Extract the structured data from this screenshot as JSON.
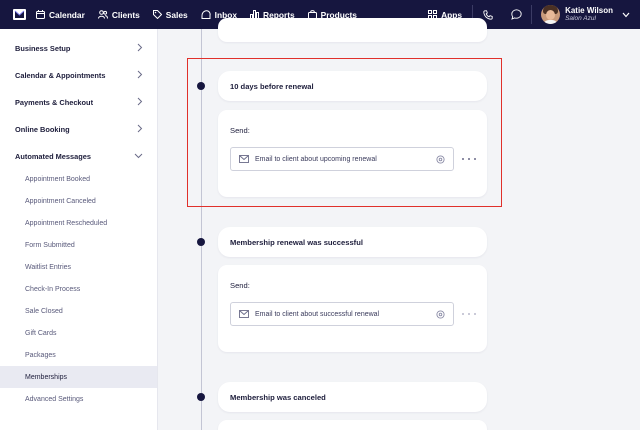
{
  "nav": {
    "items": [
      {
        "label": "Calendar",
        "icon": "calendar-icon"
      },
      {
        "label": "Clients",
        "icon": "clients-icon"
      },
      {
        "label": "Sales",
        "icon": "tag-icon"
      },
      {
        "label": "Inbox",
        "icon": "inbox-icon"
      },
      {
        "label": "Reports",
        "icon": "bar-chart-icon"
      },
      {
        "label": "Products",
        "icon": "bag-icon"
      }
    ],
    "apps_label": "Apps",
    "user": {
      "name": "Katie Wilson",
      "business": "Salon Azul"
    }
  },
  "sidebar": {
    "sections": [
      {
        "label": "Business Setup"
      },
      {
        "label": "Calendar & Appointments"
      },
      {
        "label": "Payments & Checkout"
      },
      {
        "label": "Online Booking"
      },
      {
        "label": "Automated Messages"
      }
    ],
    "sub_items": [
      {
        "label": "Appointment Booked"
      },
      {
        "label": "Appointment Canceled"
      },
      {
        "label": "Appointment Rescheduled"
      },
      {
        "label": "Form Submitted"
      },
      {
        "label": "Waitlist Entries"
      },
      {
        "label": "Check-In Process"
      },
      {
        "label": "Sale Closed"
      },
      {
        "label": "Gift Cards"
      },
      {
        "label": "Packages"
      },
      {
        "label": "Memberships",
        "active": true
      },
      {
        "label": "Advanced Settings"
      }
    ]
  },
  "timeline": {
    "events": [
      {
        "title": "10 days before renewal",
        "send_label": "Send:",
        "message": "Email to client about upcoming renewal"
      },
      {
        "title": "Membership renewal was successful",
        "send_label": "Send:",
        "message": "Email to client about successful renewal"
      },
      {
        "title": "Membership was canceled"
      }
    ]
  },
  "colors": {
    "nav_bg": "#16163f",
    "highlight_border": "#e0302b",
    "active_bg": "#e9eaf2"
  }
}
